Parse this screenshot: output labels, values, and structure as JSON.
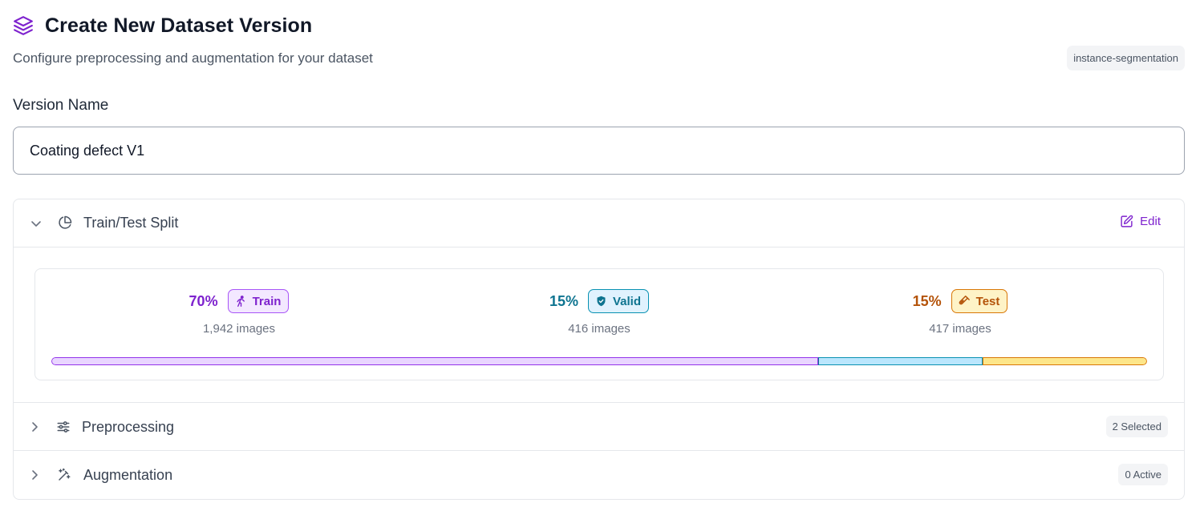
{
  "header": {
    "title": "Create New Dataset Version",
    "subtitle": "Configure preprocessing and augmentation for your dataset",
    "project_type": "instance-segmentation",
    "icon": "layers-icon"
  },
  "version_name": {
    "label": "Version Name",
    "value": "Coating defect V1"
  },
  "sections": {
    "split": {
      "title": "Train/Test Split",
      "expanded": true,
      "edit_label": "Edit",
      "train": {
        "percent_label": "70%",
        "percent": 70,
        "label": "Train",
        "images": "1,942 images",
        "color": "#7e22ce"
      },
      "valid": {
        "percent_label": "15%",
        "percent": 15,
        "label": "Valid",
        "images": "416 images",
        "color": "#0e7490"
      },
      "test": {
        "percent_label": "15%",
        "percent": 15,
        "label": "Test",
        "images": "417 images",
        "color": "#b45309"
      }
    },
    "preprocessing": {
      "title": "Preprocessing",
      "expanded": false,
      "badge": "2 Selected"
    },
    "augmentation": {
      "title": "Augmentation",
      "expanded": false,
      "badge": "0 Active"
    }
  },
  "colors": {
    "accent": "#7e22ce",
    "train_fill": "#e9d5ff",
    "valid_fill": "#bae6fd",
    "test_fill": "#fde68a"
  }
}
